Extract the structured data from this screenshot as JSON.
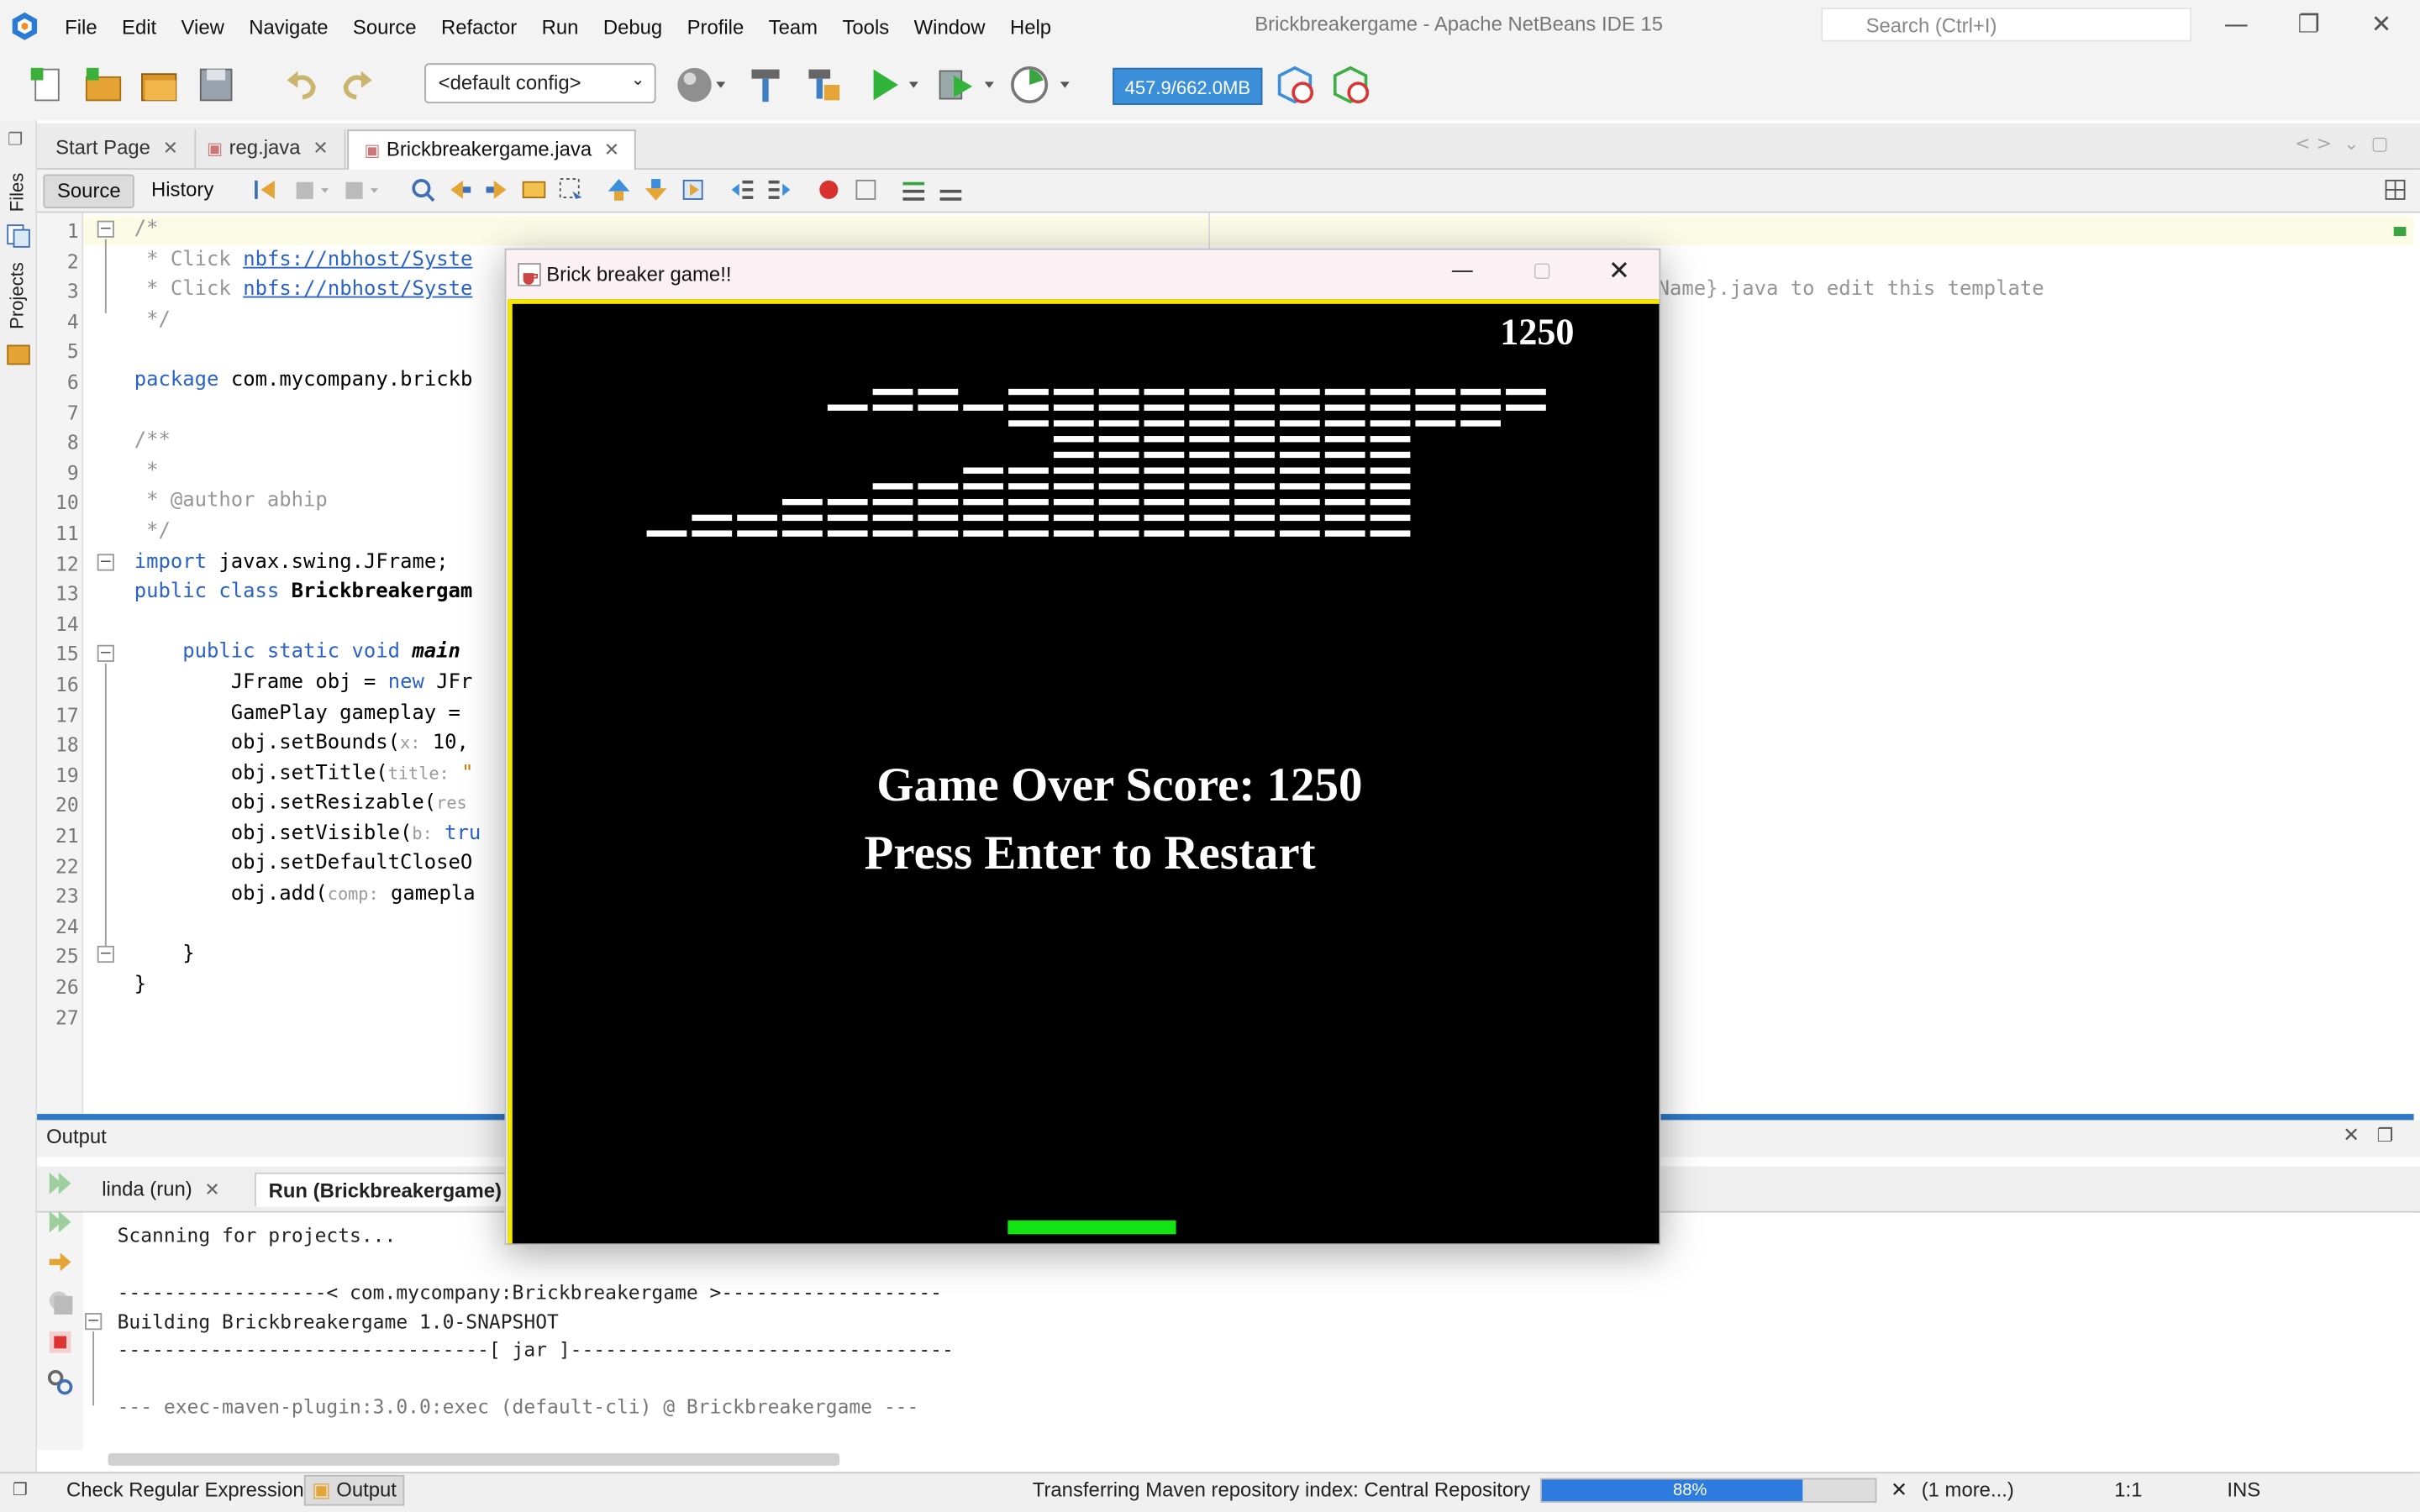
{
  "menu": {
    "items": [
      "File",
      "Edit",
      "View",
      "Navigate",
      "Source",
      "Refactor",
      "Run",
      "Debug",
      "Profile",
      "Team",
      "Tools",
      "Window",
      "Help"
    ]
  },
  "window": {
    "title": "Brickbreakergame - Apache NetBeans IDE 15",
    "search_placeholder": "Search (Ctrl+I)",
    "minimize": "—",
    "restore": "❐",
    "close": "✕"
  },
  "toolbar": {
    "config": "<default config>",
    "memory": "457.9/662.0MB"
  },
  "sidebar": {
    "files": "Files",
    "projects": "Projects"
  },
  "tabs": [
    {
      "label": "Start Page"
    },
    {
      "label": "reg.java"
    },
    {
      "label": "Brickbreakergame.java"
    }
  ],
  "editor_toolbar": {
    "source": "Source",
    "history": "History"
  },
  "editor": {
    "line_numbers": [
      "1",
      "2",
      "3",
      "4",
      "5",
      "6",
      "7",
      "8",
      "9",
      "10",
      "11",
      "12",
      "13",
      "14",
      "15",
      "16",
      "17",
      "18",
      "19",
      "20",
      "21",
      "22",
      "23",
      "24",
      "25",
      "26",
      "27"
    ],
    "l1": "/*",
    "l2a": " * Click ",
    "l2b": "nbfs://nbhost/Syste",
    "l3a": " * Click ",
    "l3b": "nbfs://nbhost/Syste",
    "l3c": "Name}.java to edit this template",
    "l4": " */",
    "l6a": "package",
    "l6b": " com.mycompany.brickb",
    "l8": "/**",
    "l9": " *",
    "l10a": " * @author ",
    "l10b": "abhip",
    "l11": " */",
    "l12a": "import",
    "l12b": " javax.swing.JFrame;",
    "l13a": "public class ",
    "l13b": "Brickbreakergam",
    "l15a": "    public static void ",
    "l15b": "main",
    "l16a": "        JFrame obj = ",
    "l16b": "new",
    "l16c": " JFr",
    "l17": "        GamePlay gameplay = ",
    "l18a": "        obj.setBounds(",
    "l18b": "x:",
    "l18c": " 10,",
    "l19a": "        obj.setTitle(",
    "l19b": "title:",
    "l19c": " \"",
    "l20a": "        obj.setResizable(",
    "l20b": "res",
    "l21a": "        obj.setVisible(",
    "l21b": "b:",
    "l21c": " tru",
    "l22": "        obj.setDefaultCloseO",
    "l23a": "        obj.add(",
    "l23b": "comp:",
    "l23c": " gamepla",
    "l25": "    }",
    "l26": "}"
  },
  "output": {
    "title": "Output",
    "tabs": [
      "linda (run)",
      "Run (Brickbreakergame)"
    ],
    "lines": [
      "Scanning for projects...",
      "",
      "------------------< com.mycompany:Brickbreakergame >-------------------",
      "Building Brickbreakergame 1.0-SNAPSHOT",
      "--------------------------------[ jar ]---------------------------------",
      "",
      "--- exec-maven-plugin:3.0.0:exec (default-cli) @ Brickbreakergame ---"
    ]
  },
  "statusbar": {
    "check_regex": "Check Regular Expression",
    "output": "Output",
    "task": "Transferring Maven repository index: Central Repository",
    "progress": 0.88,
    "progress_label": "88%",
    "more": "(1 more...)",
    "position": "1:1",
    "mode": "INS"
  },
  "game": {
    "title": "Brick breaker game!!",
    "score": "1250",
    "game_over": "Game Over Score: 1250",
    "restart": "Press Enter to Restart",
    "bricks": {
      "columns": 20,
      "rows": 10,
      "present": [
        "00000110111111111111",
        "00001111111111111111",
        "00000000111111111110",
        "00000000011111111000",
        "00000000011111111000",
        "00000001111111111000",
        "00000111111111111000",
        "00011111111111111000",
        "01111111111111111000",
        "11111111111111111000"
      ]
    },
    "colors": {
      "canvas": "#000000",
      "border": "#f7e600",
      "paddle": "#13e413",
      "bricks": "#ffffff"
    }
  }
}
